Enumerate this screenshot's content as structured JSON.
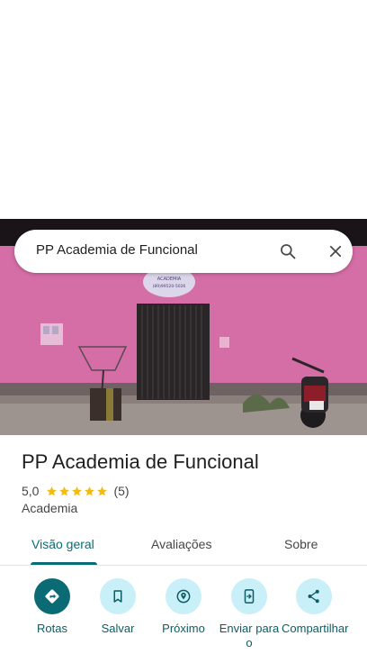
{
  "search": {
    "query": "PP Academia de Funcional"
  },
  "photo": {
    "sign_line1": "ACADEMIA",
    "sign_line2": "(89)99520-5026"
  },
  "place": {
    "title": "PP Academia de Funcional",
    "rating": "5,0",
    "stars_filled": 5,
    "review_count": "(5)",
    "category": "Academia"
  },
  "tabs": [
    {
      "label": "Visão geral",
      "active": true
    },
    {
      "label": "Avaliações"
    },
    {
      "label": "Sobre"
    }
  ],
  "actions": [
    {
      "label": "Rotas",
      "icon": "directions-icon"
    },
    {
      "label": "Salvar",
      "icon": "bookmark-icon"
    },
    {
      "label": "Próximo",
      "icon": "nearby-icon"
    },
    {
      "label": "Enviar para o",
      "icon": "send-to-phone-icon"
    },
    {
      "label": "Compartilhar",
      "icon": "share-icon"
    }
  ],
  "colors": {
    "accent": "#0b6b75",
    "action_bg": "#c9eff8",
    "star": "#f6bb06",
    "wall": "#d36fa3"
  }
}
